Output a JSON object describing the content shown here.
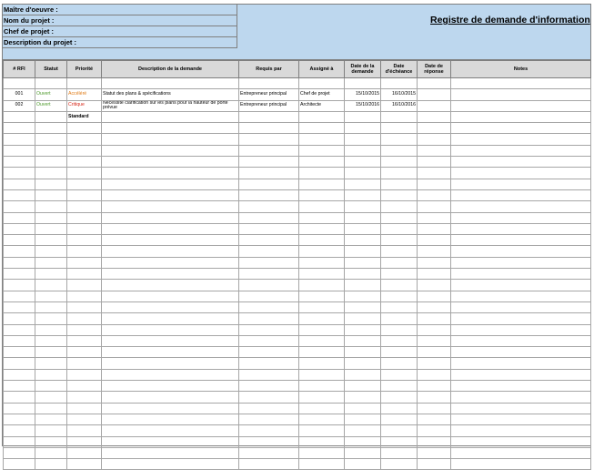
{
  "project_info": {
    "owner_label": "Maître d'oeuvre :",
    "name_label": "Nom du projet :",
    "manager_label": "Chef de projet :",
    "description_label": "Description du projet :"
  },
  "title": "Registre de demande d'information",
  "columns": {
    "rfi": "# RFI",
    "status": "Statut",
    "priority": "Priorité",
    "description": "Description de la demande",
    "requested_by": "Requis par",
    "assigned_to": "Assigné à",
    "request_date": "Date de la demande",
    "due_date": "Date d'échéance",
    "response_date": "Date de réponse",
    "notes": "Notes"
  },
  "rows": [
    {
      "rfi": "001",
      "status": "Ouvert",
      "priority": "Accéléré",
      "description": "Statut des plans & spécifications",
      "requested_by": "Entrepreneur principal",
      "assigned_to": "Chef de projet",
      "request_date": "15/10/2015",
      "due_date": "16/10/2015",
      "response_date": "",
      "notes": ""
    },
    {
      "rfi": "002",
      "status": "Ouvert",
      "priority": "Critique",
      "description": "Nécessite clarification sur les plans pour la hauteur de porte prévue",
      "requested_by": "Entrepreneur principal",
      "assigned_to": "Architecte",
      "request_date": "15/10/2016",
      "due_date": "16/10/2016",
      "response_date": "",
      "notes": ""
    },
    {
      "rfi": "",
      "status": "",
      "priority": "Standard",
      "description": "",
      "requested_by": "",
      "assigned_to": "",
      "request_date": "",
      "due_date": "",
      "response_date": "",
      "notes": ""
    }
  ],
  "colors": {
    "header_bg": "#bdd7ee",
    "column_header_bg": "#d9d9d9",
    "status_open": "#4e9a2c",
    "priority_expedited": "#e07b16",
    "priority_critical": "#d62a1a"
  }
}
